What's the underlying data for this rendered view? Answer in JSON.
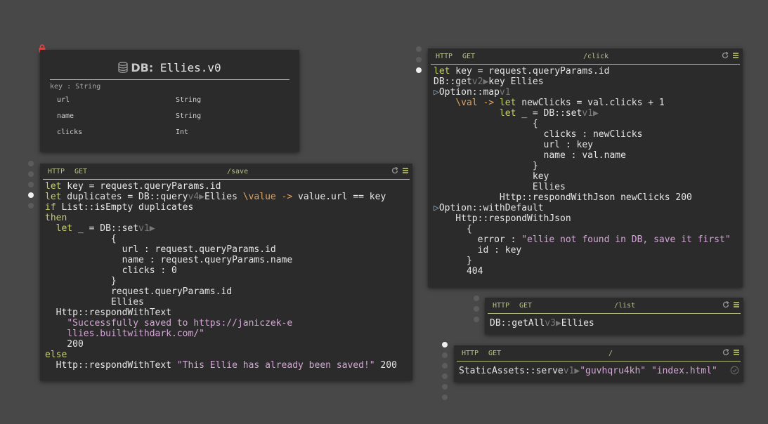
{
  "db": {
    "label": "DB:",
    "name": "Ellies.v0",
    "key": "key : String",
    "fields": [
      {
        "name": "url",
        "type": "String"
      },
      {
        "name": "name",
        "type": "String"
      },
      {
        "name": "clicks",
        "type": "Int"
      }
    ]
  },
  "handlers": {
    "save": {
      "method": "HTTP",
      "verb": "GET",
      "route": "/save"
    },
    "click": {
      "method": "HTTP",
      "verb": "GET",
      "route": "/click"
    },
    "list": {
      "method": "HTTP",
      "verb": "GET",
      "route": "/list"
    },
    "root": {
      "method": "HTTP",
      "verb": "GET",
      "route": "/"
    }
  },
  "code": {
    "save": [
      [
        [
          "kw",
          "let"
        ],
        [
          "t",
          " key = request.queryParams.id"
        ]
      ],
      [
        [
          "kw",
          "let"
        ],
        [
          "t",
          " duplicates = DB::query"
        ],
        [
          "ver",
          "v4"
        ],
        [
          "arr",
          "▶"
        ],
        [
          "t",
          "Ellies "
        ],
        [
          "lam",
          "\\value ->"
        ],
        [
          "t",
          " value.url == key"
        ]
      ],
      [
        [
          "kw",
          "if"
        ],
        [
          "t",
          " List::isEmpty duplicates"
        ]
      ],
      [
        [
          "kw",
          "then"
        ]
      ],
      [
        [
          "t",
          "  "
        ],
        [
          "kw",
          "let"
        ],
        [
          "t",
          " _ = DB::set"
        ],
        [
          "ver",
          "v1"
        ],
        [
          "arr",
          "▶"
        ]
      ],
      [
        [
          "t",
          "            {"
        ]
      ],
      [
        [
          "t",
          "              url : request.queryParams.id"
        ]
      ],
      [
        [
          "t",
          "              name : request.queryParams.name"
        ]
      ],
      [
        [
          "t",
          "              clicks : 0"
        ]
      ],
      [
        [
          "t",
          "            }"
        ]
      ],
      [
        [
          "t",
          "            request.queryParams.id"
        ]
      ],
      [
        [
          "t",
          "            Ellies"
        ]
      ],
      [
        [
          "t",
          "  Http::respondWithText"
        ]
      ],
      [
        [
          "t",
          "    "
        ],
        [
          "str",
          "\"Successfully saved to https://janiczek-e"
        ]
      ],
      [
        [
          "t",
          "    "
        ],
        [
          "str",
          "llies.builtwithdark.com/\""
        ]
      ],
      [
        [
          "t",
          "    200"
        ]
      ],
      [
        [
          "kw",
          "else"
        ]
      ],
      [
        [
          "t",
          "  Http::respondWithText "
        ],
        [
          "str",
          "\"This Ellie has already been saved!\""
        ],
        [
          "t",
          " 200"
        ]
      ]
    ],
    "click": [
      [
        [
          "kw",
          "let"
        ],
        [
          "t",
          " key = request.queryParams.id"
        ]
      ],
      [
        [
          "t",
          "DB::get"
        ],
        [
          "ver",
          "v2"
        ],
        [
          "arr",
          "▶"
        ],
        [
          "t",
          "key Ellies"
        ]
      ],
      [
        [
          "tri",
          "▷"
        ],
        [
          "t",
          "Option::map"
        ],
        [
          "ver",
          "v1"
        ]
      ],
      [
        [
          "t",
          "    "
        ],
        [
          "lam",
          "\\val ->"
        ],
        [
          "t",
          " "
        ],
        [
          "kw",
          "let"
        ],
        [
          "t",
          " newClicks = val.clicks + 1"
        ]
      ],
      [
        [
          "t",
          "            "
        ],
        [
          "kw",
          "let"
        ],
        [
          "t",
          " _ = DB::set"
        ],
        [
          "ver",
          "v1"
        ],
        [
          "arr",
          "▶"
        ]
      ],
      [
        [
          "t",
          "                  {"
        ]
      ],
      [
        [
          "t",
          "                    clicks : newClicks"
        ]
      ],
      [
        [
          "t",
          "                    url : key"
        ]
      ],
      [
        [
          "t",
          "                    name : val.name"
        ]
      ],
      [
        [
          "t",
          "                  }"
        ]
      ],
      [
        [
          "t",
          "                  key"
        ]
      ],
      [
        [
          "t",
          "                  Ellies"
        ]
      ],
      [
        [
          "t",
          "            Http::respondWithJson newClicks 200"
        ]
      ],
      [
        [
          "tri",
          "▷"
        ],
        [
          "t",
          "Option::withDefault"
        ]
      ],
      [
        [
          "t",
          "    Http::respondWithJson"
        ]
      ],
      [
        [
          "t",
          "      {"
        ]
      ],
      [
        [
          "t",
          "        error : "
        ],
        [
          "str",
          "\"ellie not found in DB, save it first\""
        ]
      ],
      [
        [
          "t",
          "        id : key"
        ]
      ],
      [
        [
          "t",
          "      }"
        ]
      ],
      [
        [
          "t",
          "      404"
        ]
      ]
    ],
    "list": [
      [
        [
          "t",
          "DB::getAll"
        ],
        [
          "ver",
          "v3"
        ],
        [
          "arr",
          "▶"
        ],
        [
          "t",
          "Ellies"
        ]
      ]
    ],
    "root": [
      [
        [
          "t",
          "StaticAssets::serve"
        ],
        [
          "ver",
          "v1"
        ],
        [
          "arr",
          "▶"
        ],
        [
          "str",
          "\"guvhqru4kh\""
        ],
        [
          "t",
          " "
        ],
        [
          "str",
          "\"index.html\""
        ]
      ]
    ]
  },
  "colors": {
    "background": "#484848",
    "card": "#2b2b2b",
    "keyword": "#c8d06a",
    "lambda": "#e2a25e",
    "string": "#d4a7d6",
    "header": "#b6c38a"
  },
  "icons": [
    "lock-icon",
    "database-icon",
    "refresh-icon",
    "menu-icon",
    "check-circle-icon"
  ]
}
